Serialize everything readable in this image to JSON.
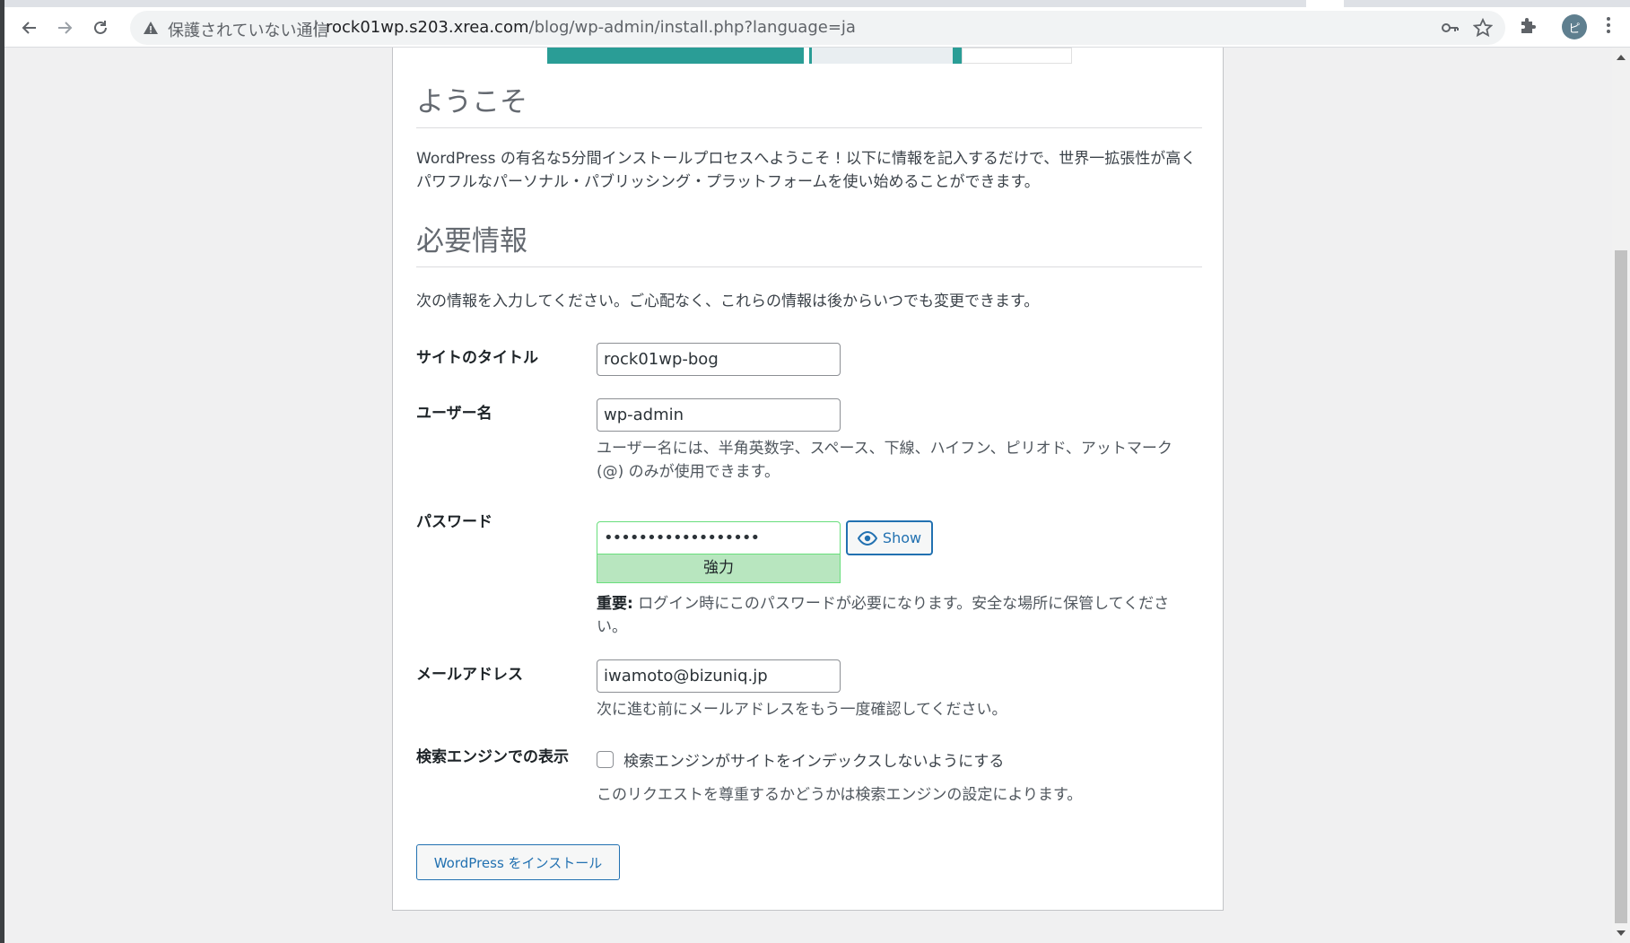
{
  "browser": {
    "security_label": "保護されていない通信",
    "divider": "|",
    "url_host": "rock01wp.s203.xrea.com",
    "url_path": "/blog/wp-admin/install.php?language=ja",
    "avatar_letter": "ピ"
  },
  "welcome": {
    "title": "ようこそ",
    "intro": "WordPress の有名な5分間インストールプロセスへようこそ ! 以下に情報を記入するだけで、世界一拡張性が高くパワフルなパーソナル・パブリッシング・プラットフォームを使い始めることができます。"
  },
  "required": {
    "title": "必要情報",
    "intro": "次の情報を入力してください。ご心配なく、これらの情報は後からいつでも変更できます。"
  },
  "form": {
    "site_title_label": "サイトのタイトル",
    "site_title_value": "rock01wp-bog",
    "username_label": "ユーザー名",
    "username_value": "wp-admin",
    "username_desc": "ユーザー名には、半角英数字、スペース、下線、ハイフン、ピリオド、アットマーク (@) のみが使用できます。",
    "password_label": "パスワード",
    "password_value": "••••••••••••••••••",
    "password_strength": "強力",
    "show_label": "Show",
    "password_important": "重要:",
    "password_desc": " ログイン時にこのパスワードが必要になります。安全な場所に保管してください。",
    "email_label": "メールアドレス",
    "email_value": "iwamoto@bizuniq.jp",
    "email_desc": "次に進む前にメールアドレスをもう一度確認してください。",
    "search_label": "検索エンジンでの表示",
    "search_checkbox_label": "検索エンジンがサイトをインデックスしないようにする",
    "search_checked": false,
    "search_desc": "このリクエストを尊重するかどうかは検索エンジンの設定によります。",
    "install_button": "WordPress をインストール"
  },
  "colors": {
    "accent": "#2271b1",
    "strength_bg": "#b8e6bf",
    "strength_border": "#68de7c"
  },
  "icons": [
    "back-arrow-icon",
    "forward-arrow-icon",
    "reload-icon",
    "warning-icon",
    "key-icon",
    "star-icon",
    "extensions-icon",
    "menu-icon",
    "eye-icon"
  ]
}
